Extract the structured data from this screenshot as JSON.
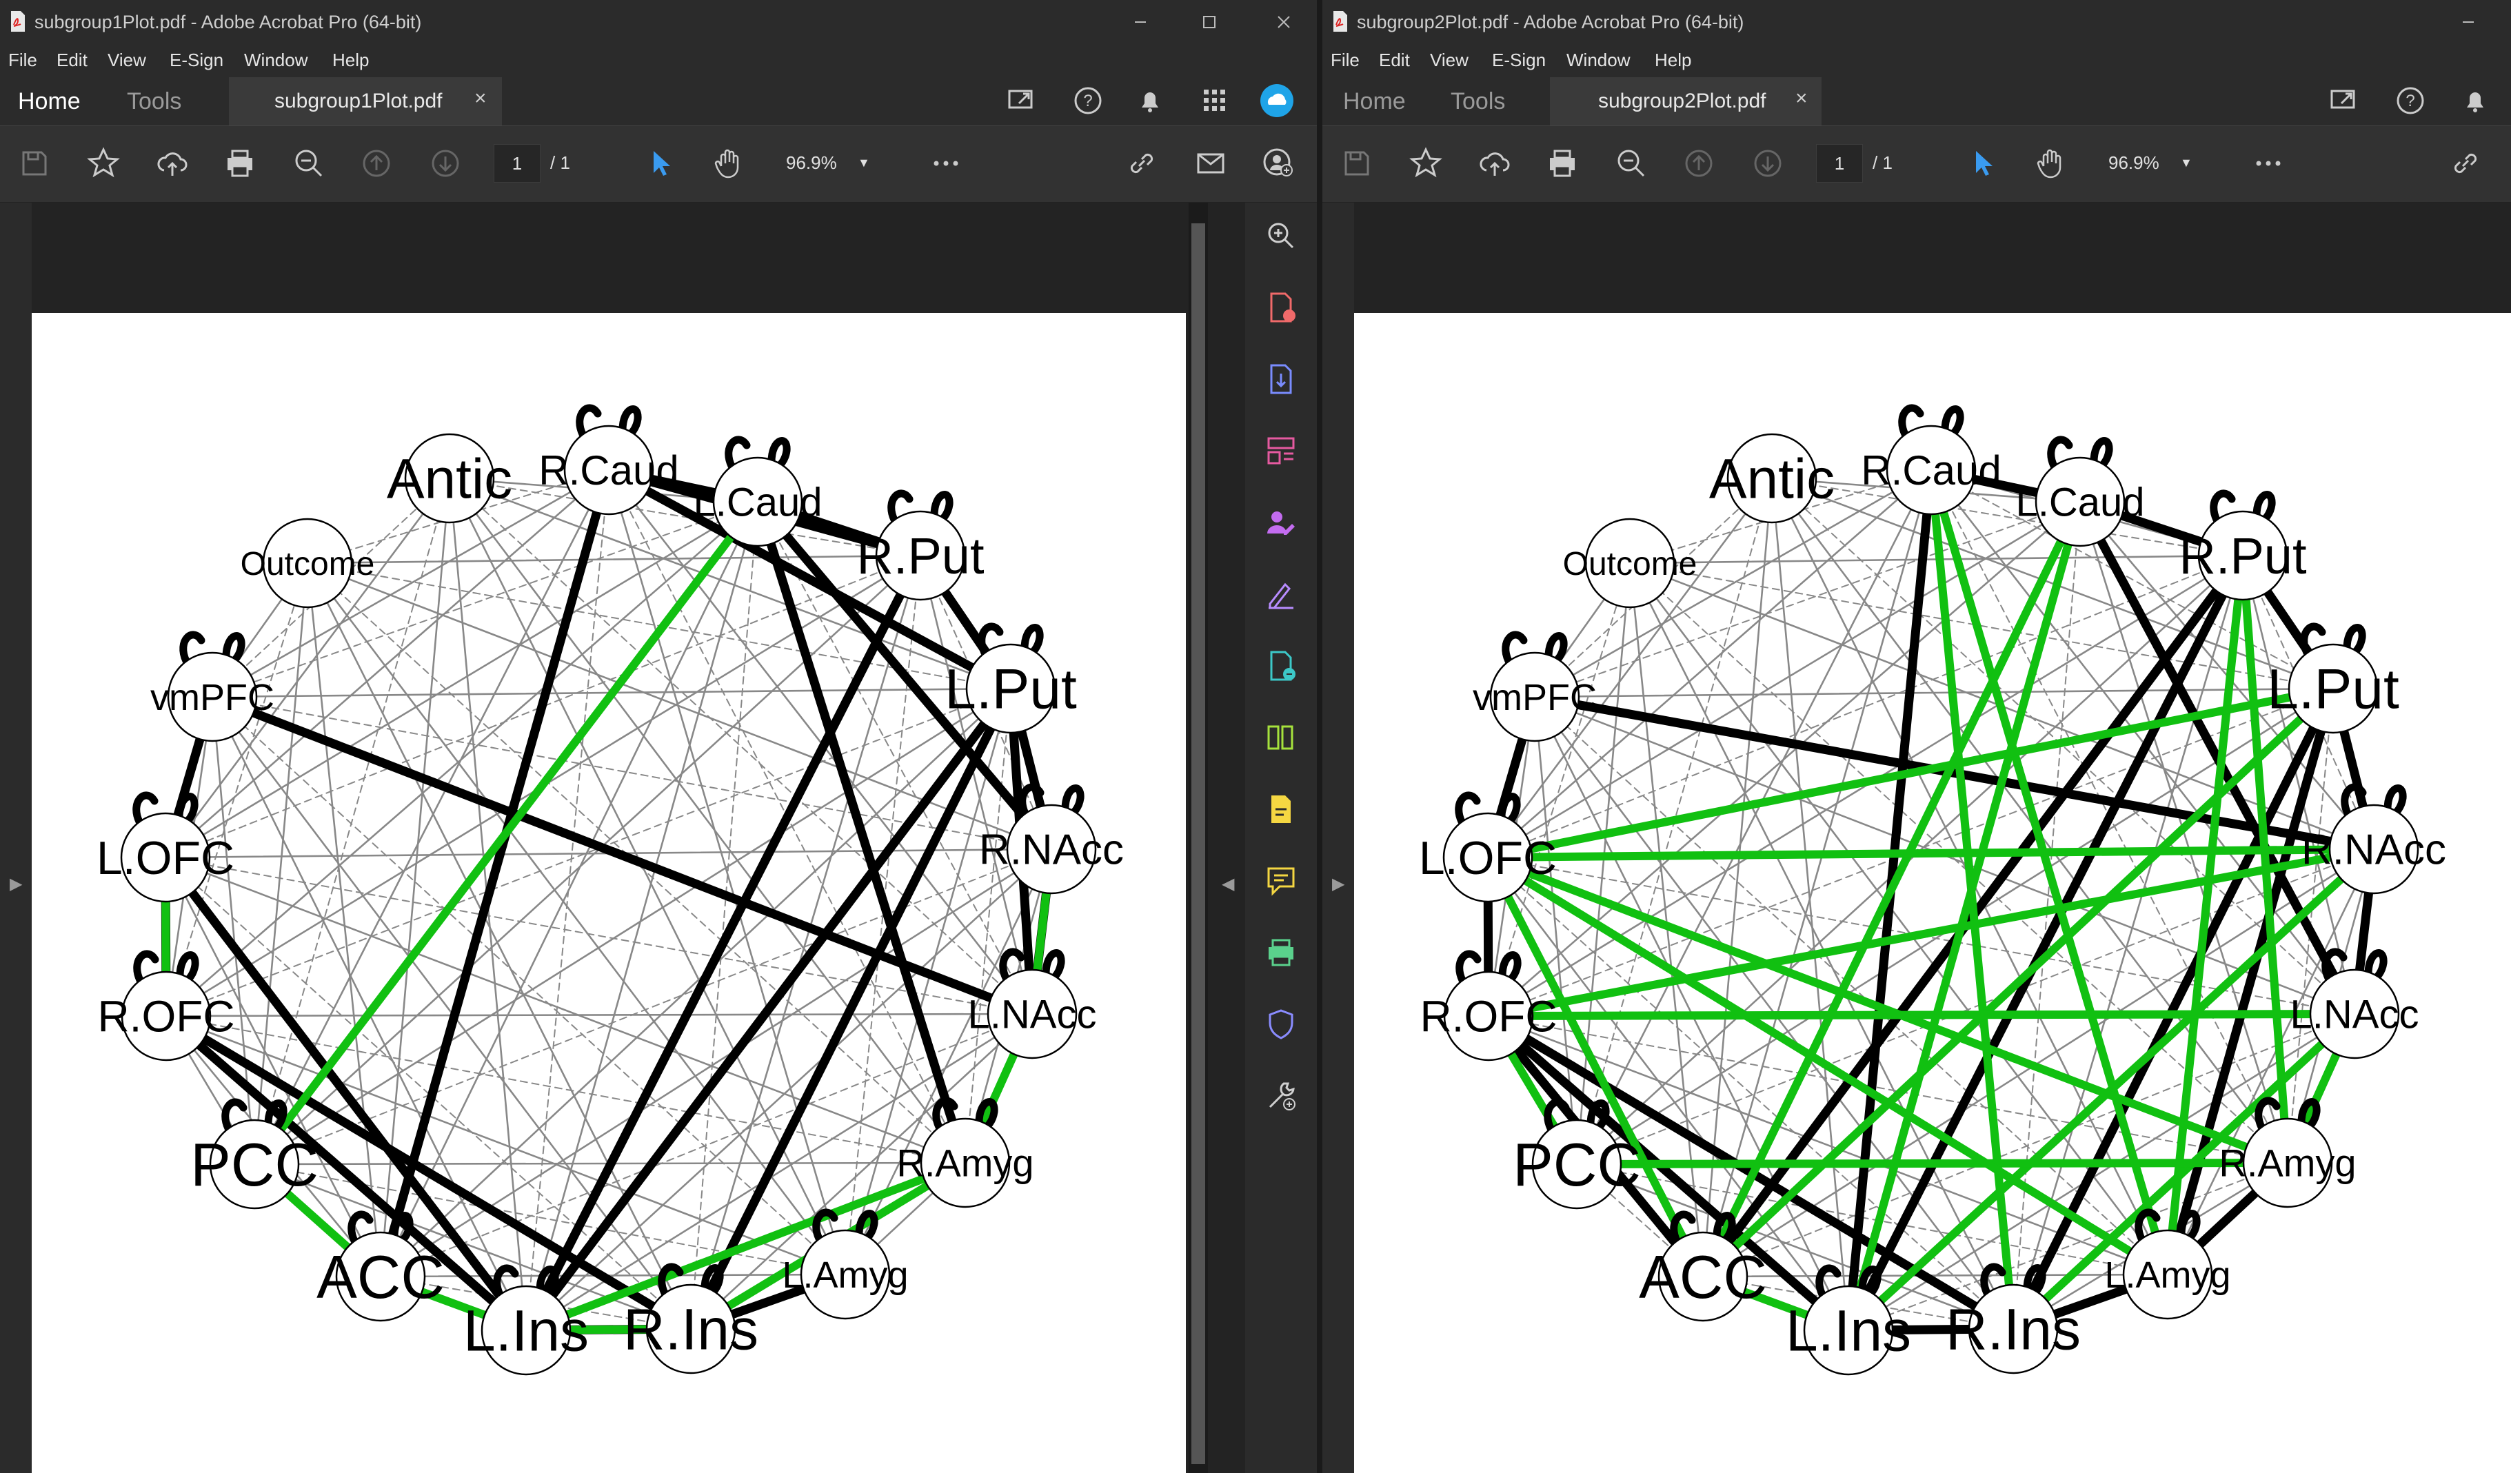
{
  "windows": [
    {
      "title": "subgroup1Plot.pdf - Adobe Acrobat Pro (64-bit)",
      "menu": [
        "File",
        "Edit",
        "View",
        "E-Sign",
        "Window",
        "Help"
      ],
      "tabs": {
        "home": "Home",
        "tools": "Tools",
        "document": "subgroup1Plot.pdf",
        "close": "×"
      },
      "page_current": "1",
      "page_total": "/ 1",
      "zoom": "96.9%"
    },
    {
      "title": "subgroup2Plot.pdf - Adobe Acrobat Pro (64-bit)",
      "menu": [
        "File",
        "Edit",
        "View",
        "E-Sign",
        "Window",
        "Help"
      ],
      "tabs": {
        "home": "Home",
        "tools": "Tools",
        "document": "subgroup2Plot.pdf",
        "close": "×"
      },
      "page_current": "1",
      "page_total": "/ 1",
      "zoom": "96.9%"
    }
  ],
  "graph": {
    "nodes": [
      "R.Caud",
      "L.Caud",
      "R.Put",
      "L.Put",
      "R.NAcc",
      "L.NAcc",
      "R.Amyg",
      "L.Amyg",
      "R.Ins",
      "L.Ins",
      "ACC",
      "PCC",
      "R.OFC",
      "L.OFC",
      "vmPFC",
      "Outcome",
      "Antic"
    ],
    "colors": {
      "positive": "#000000",
      "negative": "#11c011",
      "weak": "#888888"
    }
  },
  "icons": {
    "right_tools": [
      "search-zoom-icon",
      "create-pdf-icon",
      "export-pdf-icon",
      "organize-pages-icon",
      "request-signature-icon",
      "fill-sign-icon",
      "send-review-icon",
      "compress-icon",
      "comment-note-icon",
      "comment-icon",
      "print-production-icon",
      "protect-icon",
      "more-tools-icon"
    ],
    "right_tool_colors": [
      "#cfcfcf",
      "#f06a6a",
      "#7a8cff",
      "#e65aa0",
      "#c36cf0",
      "#b88cff",
      "#3cc8c8",
      "#a6e23c",
      "#f5d742",
      "#f5d742",
      "#5ad18c",
      "#8a8cff",
      "#cfcfcf"
    ]
  }
}
